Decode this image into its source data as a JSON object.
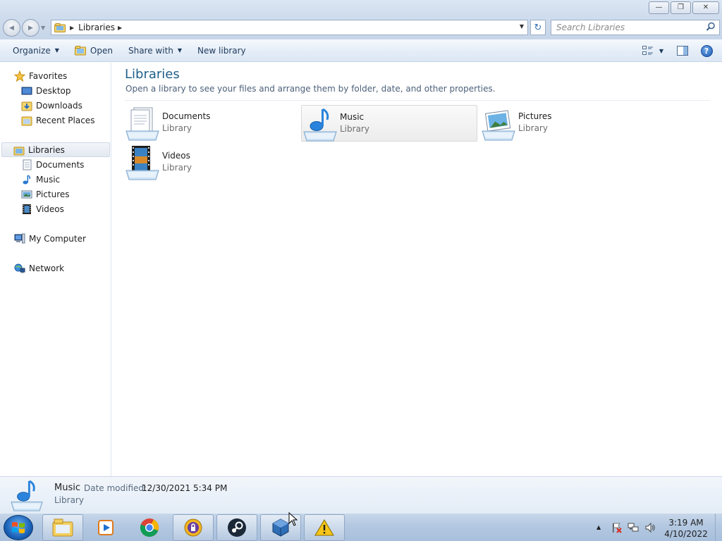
{
  "window": {
    "controls": {
      "minimize_glyph": "—",
      "maximize_glyph": "❐",
      "close_glyph": "✕"
    }
  },
  "address_bar": {
    "back_glyph": "◀",
    "forward_glyph": "▶",
    "breadcrumb": "Libraries",
    "breadcrumb_arrow": "▶",
    "dropdown_glyph": "▼",
    "refresh_glyph": "↻",
    "search_placeholder": "Search Libraries"
  },
  "toolbar": {
    "organize_label": "Organize",
    "open_label": "Open",
    "share_label": "Share with",
    "new_library_label": "New library",
    "dropdown_glyph": "▼",
    "help_glyph": "?"
  },
  "nav_pane": {
    "favorites": {
      "label": "Favorites",
      "items": [
        "Desktop",
        "Downloads",
        "Recent Places"
      ]
    },
    "libraries": {
      "label": "Libraries",
      "items": [
        "Documents",
        "Music",
        "Pictures",
        "Videos"
      ]
    },
    "computer": {
      "label": "My Computer"
    },
    "network": {
      "label": "Network"
    }
  },
  "content": {
    "title": "Libraries",
    "subtitle": "Open a library to see your files and arrange them by folder, date, and other properties.",
    "tiles": [
      {
        "name": "Documents",
        "type": "Library",
        "icon": "documents-library-icon"
      },
      {
        "name": "Music",
        "type": "Library",
        "icon": "music-library-icon",
        "selected": true
      },
      {
        "name": "Pictures",
        "type": "Library",
        "icon": "pictures-library-icon"
      },
      {
        "name": "Videos",
        "type": "Library",
        "icon": "videos-library-icon"
      }
    ]
  },
  "details_pane": {
    "name": "Music",
    "date_label": "Date modified:",
    "date_value": "12/30/2021 5:34 PM",
    "type": "Library"
  },
  "taskbar": {
    "pinned": [
      "windows-explorer-icon",
      "media-player-icon",
      "chrome-icon",
      "vpn-lock-icon",
      "steam-icon",
      "virtualbox-icon",
      "warning-icon"
    ],
    "tray_arrow": "▲",
    "clock_time": "3:19 AM",
    "clock_date": "4/10/2022"
  },
  "colors": {
    "heading_blue": "#1e5f8a",
    "chrome_blue": "#dce7f4",
    "taskbar_blue": "#b3c8e1"
  }
}
